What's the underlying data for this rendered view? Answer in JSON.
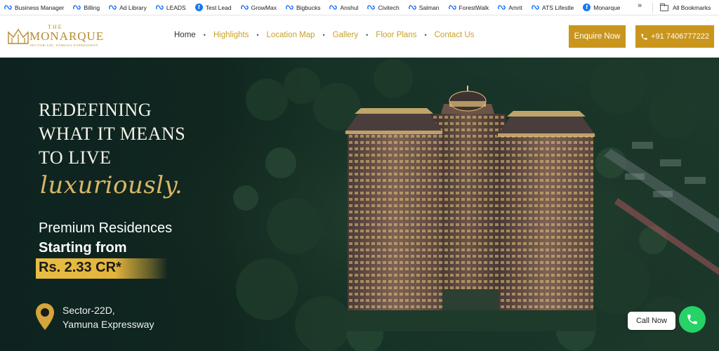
{
  "bookmarks": {
    "items": [
      {
        "label": "Business Manager",
        "icon": "meta-icon"
      },
      {
        "label": "Billing",
        "icon": "meta-icon"
      },
      {
        "label": "Ad Library",
        "icon": "meta-icon"
      },
      {
        "label": "LEADS",
        "icon": "meta-icon"
      },
      {
        "label": "Test Lead",
        "icon": "facebook-icon"
      },
      {
        "label": "GrowMax",
        "icon": "meta-icon"
      },
      {
        "label": "Bigbucks",
        "icon": "meta-icon"
      },
      {
        "label": "Anshul",
        "icon": "meta-icon"
      },
      {
        "label": "Civitech",
        "icon": "meta-icon"
      },
      {
        "label": "Salman",
        "icon": "meta-icon"
      },
      {
        "label": "ForestWalk",
        "icon": "meta-icon"
      },
      {
        "label": "Amrit",
        "icon": "meta-icon"
      },
      {
        "label": "ATS Lifestle",
        "icon": "meta-icon"
      },
      {
        "label": "Monarque",
        "icon": "facebook-icon"
      }
    ],
    "more": "»",
    "all_bookmarks": "All Bookmarks"
  },
  "logo": {
    "the": "THE",
    "name": "MONARQUE",
    "sub": "SECTOR-22D, YAMUNA EXPRESSWAY"
  },
  "nav": {
    "items": [
      {
        "label": "Home",
        "active": true
      },
      {
        "label": "Highlights"
      },
      {
        "label": "Location Map"
      },
      {
        "label": "Gallery"
      },
      {
        "label": "Floor Plans"
      },
      {
        "label": "Contact Us"
      }
    ],
    "separator": "•"
  },
  "header": {
    "enquire": "Enquire Now",
    "phone": "+91 7406777222"
  },
  "hero": {
    "headline": [
      "REDEFINING",
      "WHAT IT MEANS",
      "TO LIVE"
    ],
    "script": "luxuriously.",
    "line1": "Premium Residences",
    "line2": "Starting from",
    "price": "Rs. 2.33 CR*",
    "location1": "Sector-22D,",
    "location2": "Yamuna Expressway"
  },
  "call_now": "Call Now",
  "colors": {
    "gold": "#c9951c",
    "accent_text": "#c9a227",
    "hero_bg": "#0d1f1c",
    "whatsapp_green": "#25d366"
  }
}
